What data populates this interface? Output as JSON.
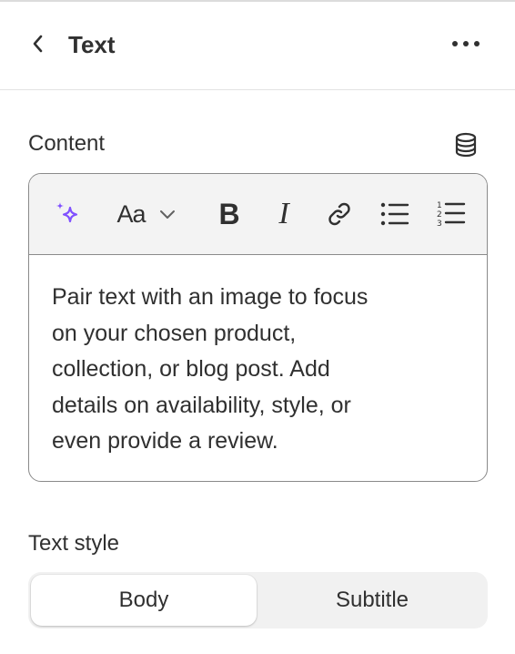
{
  "header": {
    "title": "Text",
    "back_icon": "chevron-left-icon",
    "more_icon": "ellipsis-horizontal-icon"
  },
  "content": {
    "label": "Content",
    "source_icon": "database-icon",
    "toolbar": {
      "items": [
        {
          "name": "ai-sparkle",
          "icon": "sparkle-icon",
          "color": "#8051ff"
        },
        {
          "name": "font-style",
          "label": "Aa",
          "icon": "chevron-down-icon"
        },
        {
          "name": "bold",
          "label": "B"
        },
        {
          "name": "italic",
          "label": "I"
        },
        {
          "name": "link",
          "icon": "link-icon"
        },
        {
          "name": "bullet-list",
          "icon": "bullet-list-icon"
        },
        {
          "name": "numbered-list",
          "icon": "numbered-list-icon"
        }
      ]
    },
    "text": "Pair text with an image to focus\non your chosen product,\ncollection, or blog post. Add\ndetails on availability, style, or\neven provide a review."
  },
  "text_style": {
    "label": "Text style",
    "options": [
      "Body",
      "Subtitle"
    ],
    "selected": "Body"
  },
  "colors": {
    "text": "#303030",
    "border": "#8a8a8a",
    "toolbar_bg": "#f3f3f3",
    "accent_sparkle": "#8051ff",
    "segment_bg": "#f1f1f1"
  }
}
